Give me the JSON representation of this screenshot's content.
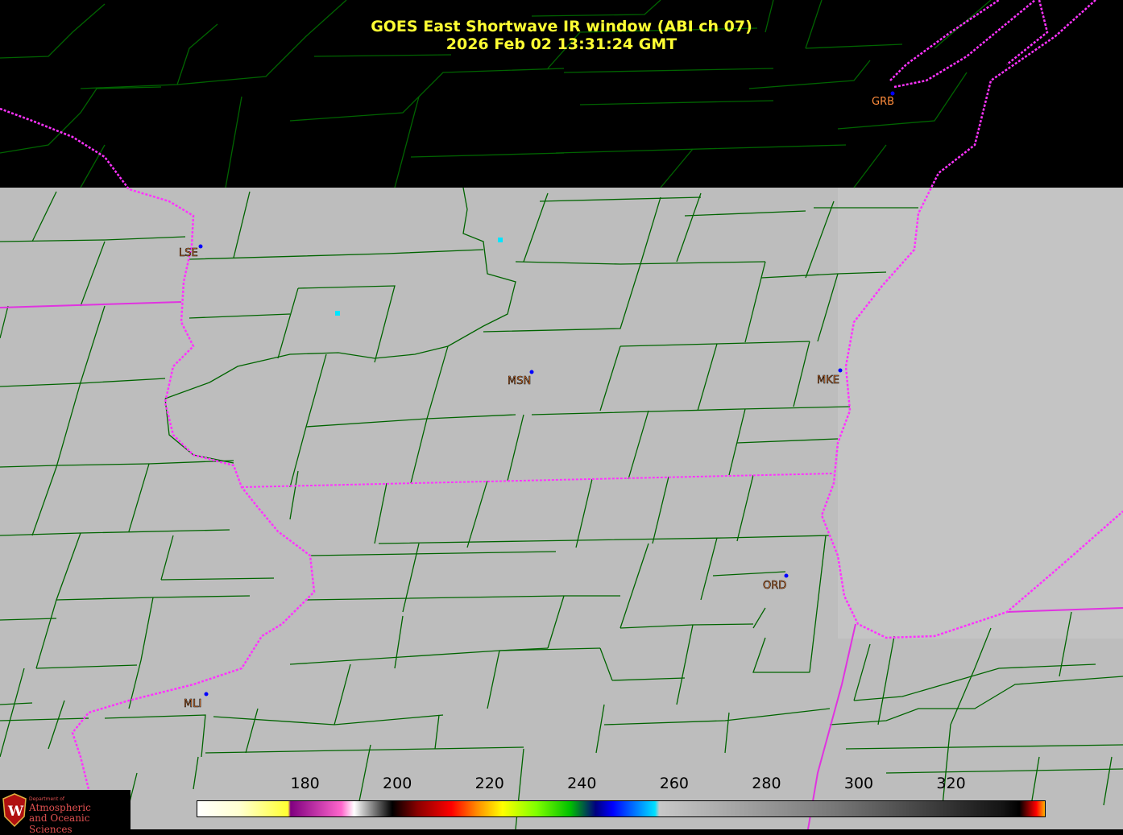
{
  "title": {
    "line1": "GOES East Shortwave IR window (ABI ch 07)",
    "line2": "2026 Feb 02  13:31:24 GMT"
  },
  "colors": {
    "title": "#ffff33",
    "state_border": "#ff33ff",
    "county_border": "#006400",
    "land_fill": "#bdbdbd",
    "station_label": "#ff8c3c",
    "station_dot": "#0000ff",
    "cold_pixel": "#00e5ff"
  },
  "stations": [
    {
      "id": "GRB"
    },
    {
      "id": "LSE"
    },
    {
      "id": "MSN"
    },
    {
      "id": "MKE"
    },
    {
      "id": "ORD"
    },
    {
      "id": "MLI"
    }
  ],
  "colorbar": {
    "ticks": [
      "180",
      "200",
      "220",
      "240",
      "260",
      "280",
      "300",
      "320"
    ],
    "tick_values": [
      180,
      200,
      220,
      240,
      260,
      280,
      300,
      320
    ]
  },
  "logo": {
    "small": "Department of",
    "line1": "Atmospheric",
    "line2": "and Oceanic Sciences"
  }
}
